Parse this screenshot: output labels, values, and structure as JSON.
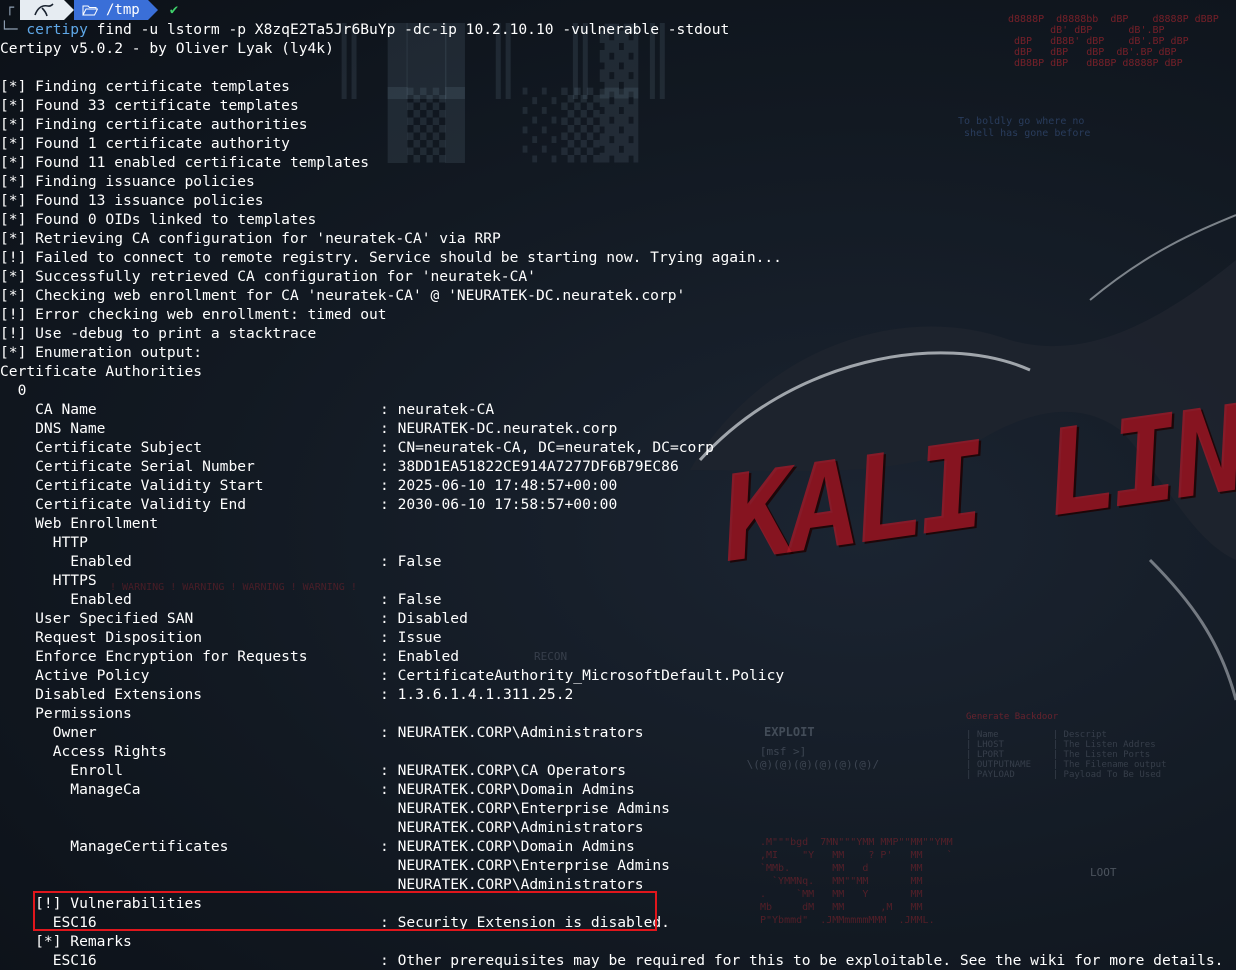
{
  "prompt": {
    "user_label": "",
    "path": "/tmp",
    "status_glyph": "✔"
  },
  "command": {
    "program": "certipy",
    "args": " find -u lstorm -p X8zqE2Ta5Jr6BuYp -dc-ip 10.2.10.10 -vulnerable -stdout"
  },
  "output": {
    "banner": "Certipy v5.0.2 - by Oliver Lyak (ly4k)",
    "log": [
      "[*] Finding certificate templates",
      "[*] Found 33 certificate templates",
      "[*] Finding certificate authorities",
      "[*] Found 1 certificate authority",
      "[*] Found 11 enabled certificate templates",
      "[*] Finding issuance policies",
      "[*] Found 13 issuance policies",
      "[*] Found 0 OIDs linked to templates",
      "[*] Retrieving CA configuration for 'neuratek-CA' via RRP",
      "[!] Failed to connect to remote registry. Service should be starting now. Trying again...",
      "[*] Successfully retrieved CA configuration for 'neuratek-CA'",
      "[*] Checking web enrollment for CA 'neuratek-CA' @ 'NEURATEK-DC.neuratek.corp'",
      "[!] Error checking web enrollment: timed out",
      "[!] Use -debug to print a stacktrace",
      "[*] Enumeration output:"
    ],
    "section_title": "Certificate Authorities",
    "ca_index": "  0",
    "rows": [
      {
        "k": "    CA Name",
        "v": ": neuratek-CA"
      },
      {
        "k": "    DNS Name",
        "v": ": NEURATEK-DC.neuratek.corp"
      },
      {
        "k": "    Certificate Subject",
        "v": ": CN=neuratek-CA, DC=neuratek, DC=corp"
      },
      {
        "k": "    Certificate Serial Number",
        "v": ": 38DD1EA51822CE914A7277DF6B79EC86"
      },
      {
        "k": "    Certificate Validity Start",
        "v": ": 2025-06-10 17:48:57+00:00"
      },
      {
        "k": "    Certificate Validity End",
        "v": ": 2030-06-10 17:58:57+00:00"
      },
      {
        "k": "    Web Enrollment",
        "v": ""
      },
      {
        "k": "      HTTP",
        "v": ""
      },
      {
        "k": "        Enabled",
        "v": ": False"
      },
      {
        "k": "      HTTPS",
        "v": ""
      },
      {
        "k": "        Enabled",
        "v": ": False"
      },
      {
        "k": "    User Specified SAN",
        "v": ": Disabled"
      },
      {
        "k": "    Request Disposition",
        "v": ": Issue"
      },
      {
        "k": "    Enforce Encryption for Requests",
        "v": ": Enabled"
      },
      {
        "k": "    Active Policy",
        "v": ": CertificateAuthority_MicrosoftDefault.Policy"
      },
      {
        "k": "    Disabled Extensions",
        "v": ": 1.3.6.1.4.1.311.25.2"
      },
      {
        "k": "    Permissions",
        "v": ""
      },
      {
        "k": "      Owner",
        "v": ": NEURATEK.CORP\\Administrators"
      },
      {
        "k": "      Access Rights",
        "v": ""
      },
      {
        "k": "        Enroll",
        "v": ": NEURATEK.CORP\\CA Operators"
      },
      {
        "k": "        ManageCa",
        "v": ": NEURATEK.CORP\\Domain Admins"
      },
      {
        "k": "",
        "v": "  NEURATEK.CORP\\Enterprise Admins"
      },
      {
        "k": "",
        "v": "  NEURATEK.CORP\\Administrators"
      },
      {
        "k": "        ManageCertificates",
        "v": ": NEURATEK.CORP\\Domain Admins"
      },
      {
        "k": "",
        "v": "  NEURATEK.CORP\\Enterprise Admins"
      },
      {
        "k": "",
        "v": "  NEURATEK.CORP\\Administrators"
      },
      {
        "k": "    [!] Vulnerabilities",
        "v": ""
      },
      {
        "k": "      ESC16",
        "v": ": Security Extension is disabled."
      },
      {
        "k": "    [*] Remarks",
        "v": ""
      },
      {
        "k": "      ESC16",
        "v": ": Other prerequisites may be required for this to be exploitable. See the wiki for more details."
      }
    ]
  },
  "wallpaper": {
    "logo_text": "KALI LINUX",
    "motto": "To boldly go where no\n shell has gone before",
    "exploit_label": "EXPLOIT",
    "recon_label": "RECON",
    "loot_label": "LOOT",
    "generate_backdoor": "Generate Backdoor",
    "warning_text": "! WARNING ! WARNING ! WARNING ! WARNING !",
    "colors": {
      "accent_red": "#c8283a",
      "highlight": "#e0161c",
      "path_blue": "#3a6fd8",
      "cmd_blue": "#5fa8e8"
    }
  }
}
